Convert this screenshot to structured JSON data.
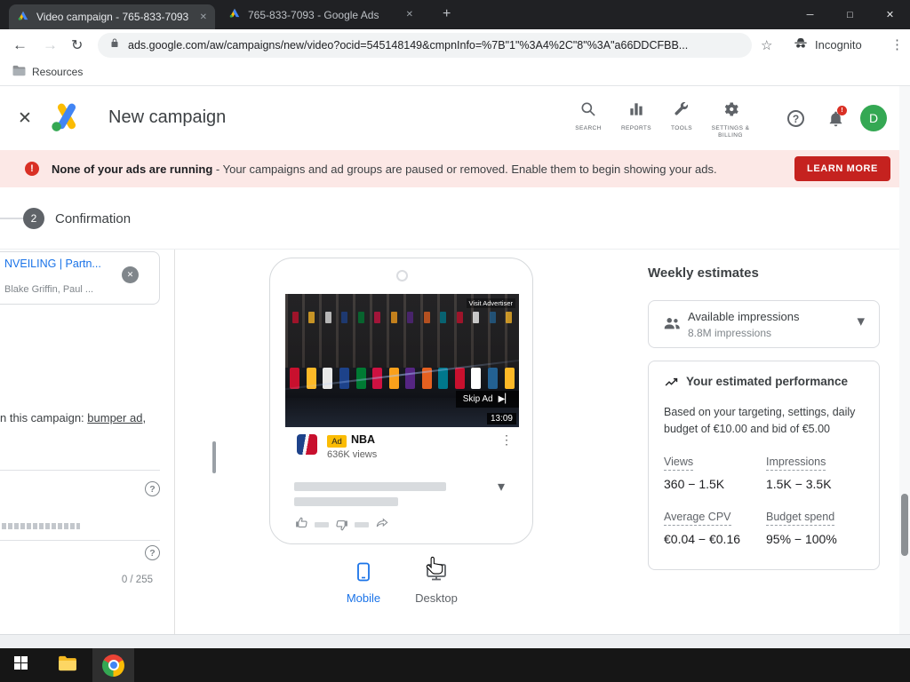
{
  "browser": {
    "tabs": [
      {
        "title": "Video campaign - 765-833-7093",
        "active": true
      },
      {
        "title": "765-833-7093 - Google Ads",
        "active": false
      }
    ],
    "url": "ads.google.com/aw/campaigns/new/video?ocid=545148149&cmpnInfo=%7B\"1\"%3A4%2C\"8\"%3A\"a66DDCFBB...",
    "incognito_label": "Incognito",
    "bookmarks": [
      {
        "label": "Resources"
      }
    ]
  },
  "icons": {
    "back": "←",
    "forward": "→",
    "reload": "↻",
    "star": "☆",
    "menu": "⋮",
    "new_tab": "+",
    "tab_close": "✕",
    "window_minimize": "─",
    "window_maximize": "□",
    "window_close": "✕",
    "close": "✕",
    "kebab": "⋮",
    "chevron_down": "▾",
    "skip": "▶▏",
    "help": "?"
  },
  "header": {
    "title": "New campaign",
    "nav_items": [
      {
        "label": "SEARCH"
      },
      {
        "label": "REPORTS"
      },
      {
        "label": "TOOLS"
      },
      {
        "label": "SETTINGS & BILLING"
      }
    ],
    "notification_badge": "!",
    "avatar_initial": "D"
  },
  "alert": {
    "icon": "!",
    "title": "None of your ads are running",
    "message": " - Your campaigns and ad groups are paused or removed. Enable them to begin showing your ads.",
    "action_label": "LEARN MORE"
  },
  "stepper": {
    "step_number": "2",
    "step_label": "Confirmation"
  },
  "left_panel": {
    "ad_card": {
      "title": "NVEILING | Partn...",
      "subtitle": "Blake Griffin, Paul ..."
    },
    "note_prefix": "n this campaign: ",
    "note_link": "bumper ad",
    "note_suffix": ",",
    "char_counter": "0 / 255"
  },
  "preview": {
    "video": {
      "visit_advertiser": "Visit Advertiser",
      "skip_label": "Skip Ad",
      "duration": "13:09",
      "jersey_colors": [
        "#c8102e",
        "#fdb927",
        "#e8e8e8",
        "#1d428a",
        "#007a33",
        "#ce1141",
        "#f9a01b",
        "#552583",
        "#e56020",
        "#00788c",
        "#c8102e",
        "#ffffff",
        "#236192",
        "#fdb927"
      ]
    },
    "ad": {
      "badge": "Ad",
      "channel": "NBA",
      "views": "636K views"
    },
    "device_toggle": [
      {
        "label": "Mobile",
        "active": true
      },
      {
        "label": "Desktop",
        "active": false
      }
    ]
  },
  "estimates": {
    "title": "Weekly estimates",
    "impressions": {
      "label": "Available impressions",
      "value": "8.8M impressions"
    },
    "performance": {
      "title": "Your estimated performance",
      "description": "Based on your targeting, settings, daily budget of €10.00 and bid of €5.00",
      "metrics": [
        {
          "label": "Views",
          "value": "360 − 1.5K"
        },
        {
          "label": "Impressions",
          "value": "1.5K − 3.5K"
        },
        {
          "label": "Average CPV",
          "value": "€0.04 − €0.16"
        },
        {
          "label": "Budget spend",
          "value": "95% − 100%"
        }
      ]
    }
  },
  "colors": {
    "accent_blue": "#1a73e8",
    "alert_bg": "#fce8e6",
    "alert_button": "#c5221f",
    "ad_badge_yellow": "#fbbc04",
    "avatar_green": "#34a853",
    "notification_red": "#d93025"
  }
}
